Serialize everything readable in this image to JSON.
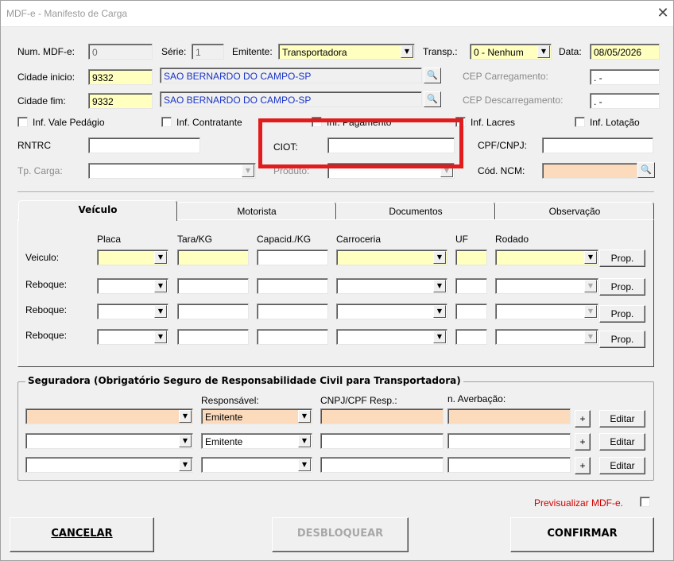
{
  "window": {
    "title": "MDF-e - Manifesto de Carga",
    "close": "✕"
  },
  "header": {
    "num_label": "Num. MDF-e:",
    "num_value": "0",
    "serie_label": "Série:",
    "serie_value": "1",
    "emitente_label": "Emitente:",
    "emitente_value": "Transportadora",
    "transp_label": "Transp.:",
    "transp_value": "0 - Nenhum",
    "data_label": "Data:",
    "data_value": "08/05/2026",
    "cidade_inicio_label": "Cidade inicio:",
    "cidade_inicio_code": "9332",
    "cidade_inicio_name": "SAO BERNARDO DO CAMPO-SP",
    "cidade_fim_label": "Cidade fim:",
    "cidade_fim_code": "9332",
    "cidade_fim_name": "SAO BERNARDO DO CAMPO-SP",
    "cep_carregamento_label": "CEP Carregamento:",
    "cep_carregamento_value": "  .   -",
    "cep_descarregamento_label": "CEP Descarregamento:",
    "cep_descarregamento_value": "  .   -"
  },
  "checkboxes": {
    "vale_pedagio": "Inf. Vale Pedágio",
    "contratante": "Inf. Contratante",
    "pagamento": "Inf. Pagamento",
    "lacres": "Inf. Lacres",
    "lotacao": "Inf. Lotação"
  },
  "fields": {
    "rntrc_label": "RNTRC",
    "ciot_label": "CIOT:",
    "cpf_cnpj_label": "CPF/CNPJ:",
    "tp_carga_label": "Tp. Carga:",
    "produto_label": "Produto:",
    "ncm_label": "Cód. NCM:"
  },
  "tabs": [
    {
      "label": "Veículo",
      "active": true
    },
    {
      "label": "Motorista",
      "active": false
    },
    {
      "label": "Documentos",
      "active": false
    },
    {
      "label": "Observação",
      "active": false
    }
  ],
  "vehicle_table": {
    "columns": [
      "Placa",
      "Tara/KG",
      "Capacid./KG",
      "Carroceria",
      "UF",
      "Rodado"
    ],
    "rows": [
      "Veiculo:",
      "Reboque:",
      "Reboque:",
      "Reboque:"
    ],
    "prop_label": "Prop."
  },
  "seguradora": {
    "title": "Seguradora (Obrigatório Seguro de Responsabilidade Civil para Transportadora)",
    "responsavel_label": "Responsável:",
    "cnpj_resp_label": "CNPJ/CPF Resp.:",
    "averbacao_label": "n. Averbação:",
    "rows": [
      {
        "responsavel": "Emitente"
      },
      {
        "responsavel": "Emitente"
      },
      {
        "responsavel": ""
      }
    ],
    "plus_label": "+",
    "editar_label": "Editar"
  },
  "previsualizar_label": "Previsualizar MDF-e.",
  "buttons": {
    "cancelar": "CANCELAR",
    "desbloquear": "DESBLOQUEAR",
    "confirmar": "CONFIRMAR"
  },
  "colors": {
    "required_yellow": "#ffffc0",
    "required_orange": "#fcdbbd",
    "highlight_red": "#e21c1c",
    "link_blue": "#1a34c8"
  }
}
